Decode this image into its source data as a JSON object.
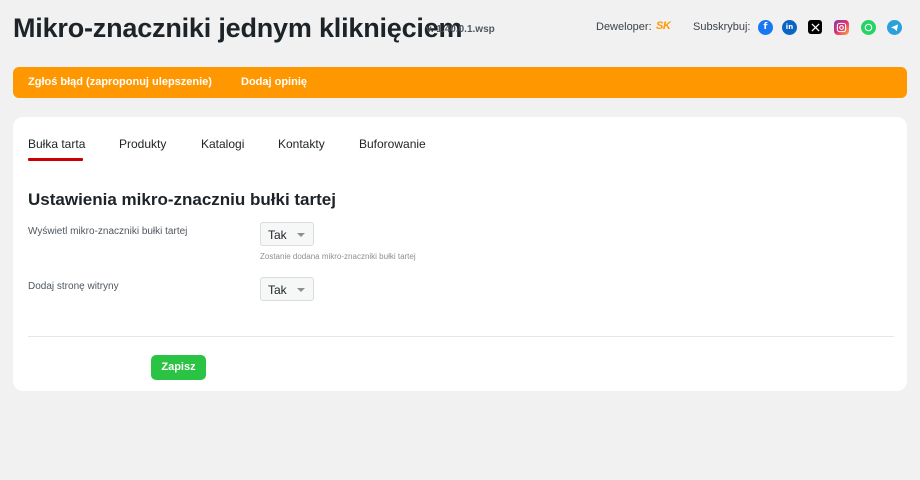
{
  "header": {
    "title": "Mikro-znaczniki jednym kliknięciem",
    "version": "v. 1.40.0.1.wsp",
    "developer_label": "Deweloper:",
    "developer_logo": "SK",
    "subscribe_label": "Subskrybuj:",
    "social": [
      {
        "name": "facebook-icon",
        "glyph": "f",
        "color": "#1877f2"
      },
      {
        "name": "linkedin-icon",
        "glyph": "in",
        "color": "#0a66c2"
      },
      {
        "name": "x-icon",
        "glyph": "𝕏",
        "color": "#000000"
      },
      {
        "name": "instagram-icon",
        "glyph": "◎",
        "color": "#e1306c"
      },
      {
        "name": "whatsapp-icon",
        "glyph": "✆",
        "color": "#25d366"
      },
      {
        "name": "telegram-icon",
        "glyph": "➤",
        "color": "#2aa1d9"
      }
    ]
  },
  "banner": {
    "report_label": "Zgłoś błąd (zaproponuj ulepszenie)",
    "review_label": "Dodaj opinię",
    "color": "#ff9800"
  },
  "tabs": [
    {
      "label": "Bułka tarta",
      "active": true
    },
    {
      "label": "Produkty",
      "active": false
    },
    {
      "label": "Katalogi",
      "active": false
    },
    {
      "label": "Kontakty",
      "active": false
    },
    {
      "label": "Buforowanie",
      "active": false
    }
  ],
  "settings": {
    "section_title": "Ustawienia mikro-znaczniu bułki tartej",
    "fields": [
      {
        "label": "Wyświetl mikro-znaczniki bułki tartej",
        "value": "Tak",
        "hint": "Zostanie dodana mikro-znaczniki bułki tartej"
      },
      {
        "label": "Dodaj stronę witryny",
        "value": "Tak"
      }
    ],
    "save_label": "Zapisz",
    "save_color": "#2bc344"
  }
}
